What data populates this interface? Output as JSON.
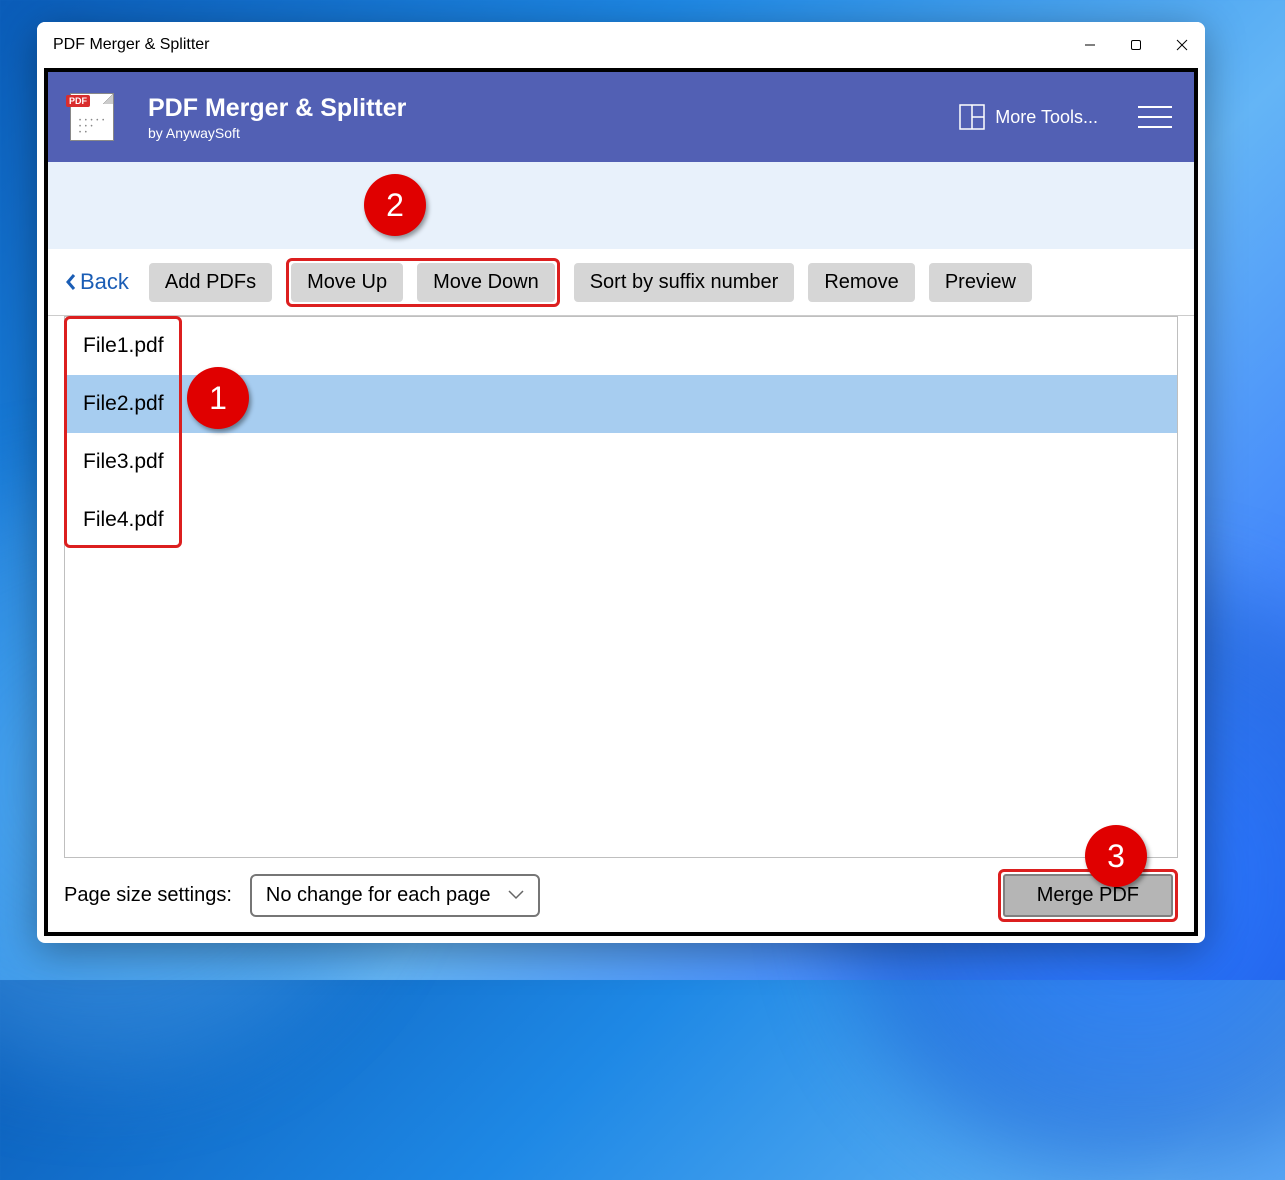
{
  "window": {
    "title": "PDF Merger & Splitter"
  },
  "header": {
    "title": "PDF Merger & Splitter",
    "subtitle": "by AnywaySoft",
    "icon_badge": "PDF",
    "more_tools": "More Tools..."
  },
  "toolbar": {
    "back": "Back",
    "add_pdfs": "Add PDFs",
    "move_up": "Move Up",
    "move_down": "Move Down",
    "sort_suffix": "Sort by suffix number",
    "remove": "Remove",
    "preview": "Preview"
  },
  "files": [
    {
      "name": "File1.pdf",
      "selected": false
    },
    {
      "name": "File2.pdf",
      "selected": true
    },
    {
      "name": "File3.pdf",
      "selected": false
    },
    {
      "name": "File4.pdf",
      "selected": false
    }
  ],
  "footer": {
    "page_size_label": "Page size settings:",
    "page_size_value": "No change for each page",
    "merge_label": "Merge PDF"
  },
  "annotations": {
    "b1": "1",
    "b2": "2",
    "b3": "3"
  }
}
